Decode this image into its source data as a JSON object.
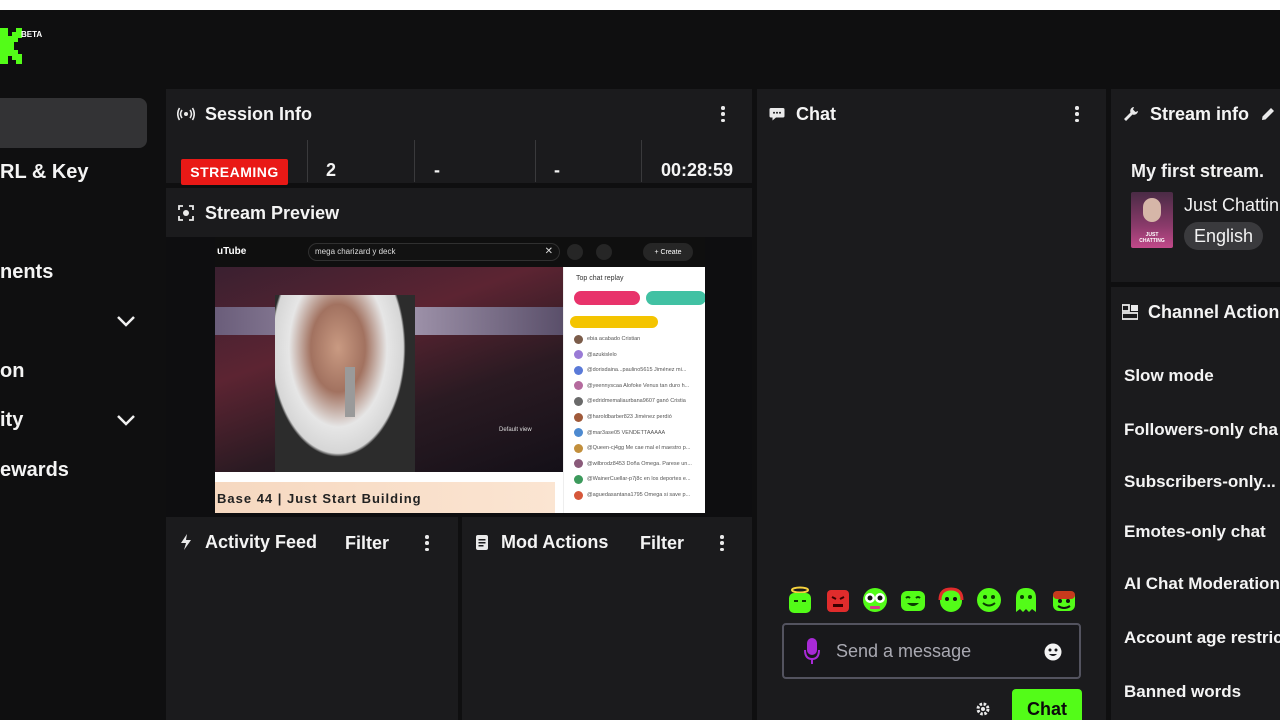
{
  "brand": {
    "beta": "BETA",
    "accent": "#53fc18"
  },
  "sidebar": {
    "items": [
      {
        "label": "RL & Key"
      },
      {
        "label": "nents"
      },
      {
        "label": "on"
      },
      {
        "label": "ity"
      },
      {
        "label": "ewards"
      }
    ]
  },
  "session_info": {
    "title": "Session Info",
    "status_badge": "STREAMING",
    "stats": [
      "2",
      "-",
      "-",
      "00:28:59"
    ]
  },
  "stream_preview": {
    "title": "Stream Preview",
    "content": {
      "search_text": "mega charizard y deck",
      "site_label": "uTube",
      "create_label": "Create",
      "top_chat_label": "Top chat replay",
      "video_caption": "Base 44 | Just Start Building",
      "default_view": "Default view",
      "chat_lines": [
        "ebia acabado Cristian",
        "@azukislelo",
        "@dorisdaina...paulino5615 Jiménez mi...",
        "@yeennyscaa Alofoke Venus tan duro h...",
        "@edridmemaliaurbana9607 ganó Cristia",
        "@haroldbarber823 Jiménez perdió",
        "@mar3ase05 VENDETTAAAAA",
        "@Queen-cj4gg Me cae mal el maestro p...",
        "@wilbrodz8453 Doña Omega. Parese un...",
        "@WainerCuellar-p7j8c en los deportes e...",
        "@aguedasantana1795 Omega si save p..."
      ]
    }
  },
  "activity_feed": {
    "title": "Activity Feed",
    "filter_label": "Filter"
  },
  "mod_actions": {
    "title": "Mod Actions",
    "filter_label": "Filter"
  },
  "chat": {
    "title": "Chat",
    "input_placeholder": "Send a message",
    "send_label": "Chat"
  },
  "stream_info": {
    "title": "Stream info",
    "stream_title": "My first stream.",
    "category": "Just Chattin",
    "category_thumb_text": "JUST CHATTING",
    "language": "English"
  },
  "channel_actions": {
    "title": "Channel Actions",
    "items": [
      "Slow mode",
      "Followers-only cha",
      "Subscribers-only...",
      "Emotes-only chat",
      "AI Chat Moderation",
      "Account age restric",
      "Banned words"
    ]
  }
}
